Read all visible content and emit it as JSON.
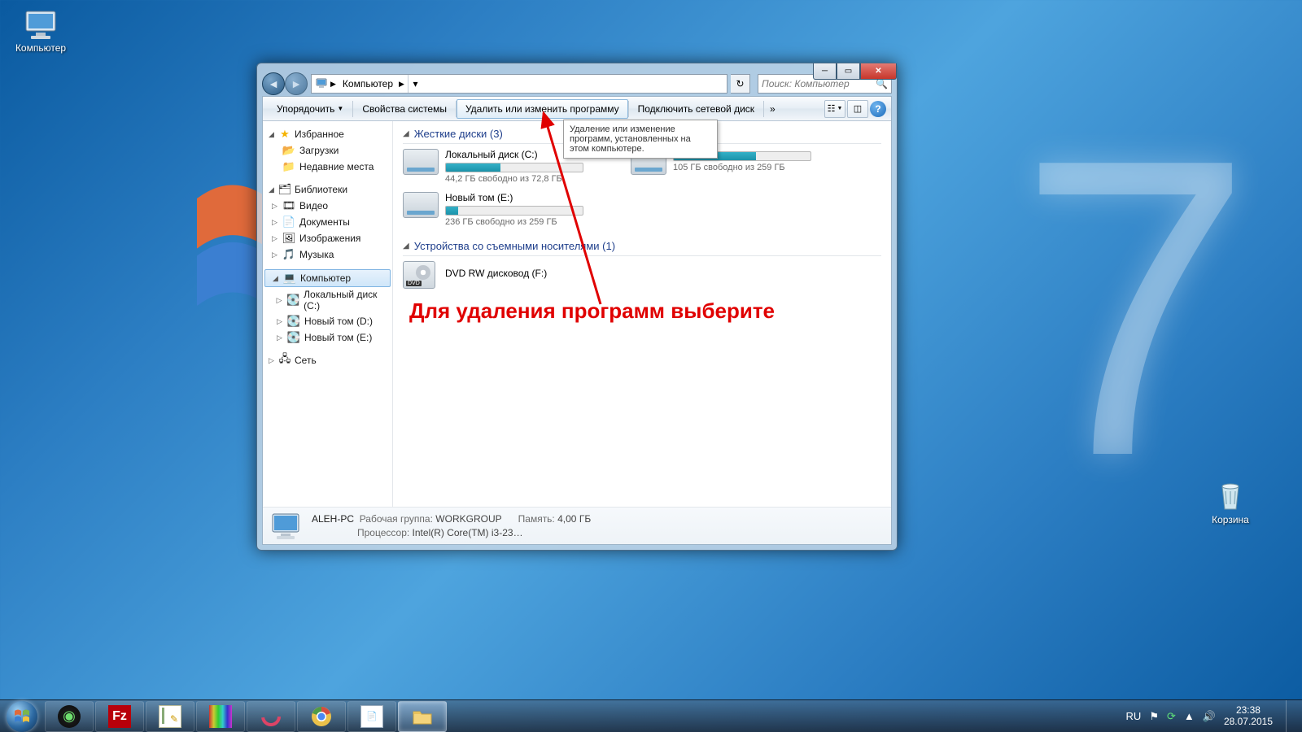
{
  "desktop": {
    "computer_label": "Компьютер",
    "recycle_label": "Корзина"
  },
  "window": {
    "breadcrumb": {
      "root_icon": "computer-icon",
      "item": "Компьютер"
    },
    "search_placeholder": "Поиск: Компьютер",
    "toolbar": {
      "organize": "Упорядочить",
      "properties": "Свойства системы",
      "uninstall": "Удалить или изменить программу",
      "map_drive": "Подключить сетевой диск",
      "overflow": "»"
    },
    "tooltip": "Удаление или изменение программ, установленных на этом компьютере.",
    "nav": {
      "favorites": "Избранное",
      "downloads": "Загрузки",
      "recent": "Недавние места",
      "libraries": "Библиотеки",
      "video": "Видео",
      "documents": "Документы",
      "pictures": "Изображения",
      "music": "Музыка",
      "computer": "Компьютер",
      "local_c": "Локальный диск (C:)",
      "vol_d": "Новый том (D:)",
      "vol_e": "Новый том (E:)",
      "network": "Сеть"
    },
    "content": {
      "hard_drives_header": "Жесткие диски (3)",
      "removable_header": "Устройства со съемными носителями (1)",
      "drives": {
        "c": {
          "name": "Локальный диск (C:)",
          "free": "44,2 ГБ свободно из 72,8 ГБ",
          "fill_pct": 40
        },
        "d": {
          "name": "",
          "free": "105 ГБ свободно из 259 ГБ",
          "fill_pct": 60
        },
        "e": {
          "name": "Новый том (E:)",
          "free": "236 ГБ свободно из 259 ГБ",
          "fill_pct": 9
        }
      },
      "dvd": {
        "name": "DVD RW дисковод (F:)"
      }
    },
    "details": {
      "name": "ALEH-PC",
      "workgroup_label": "Рабочая группа:",
      "workgroup": "WORKGROUP",
      "memory_label": "Память:",
      "memory": "4,00 ГБ",
      "cpu_label": "Процессор:",
      "cpu": "Intel(R) Core(TM) i3-23…"
    }
  },
  "annotation": {
    "text": "Для удаления программ выберите"
  },
  "taskbar": {
    "lang": "RU",
    "time": "23:38",
    "date": "28.07.2015"
  }
}
